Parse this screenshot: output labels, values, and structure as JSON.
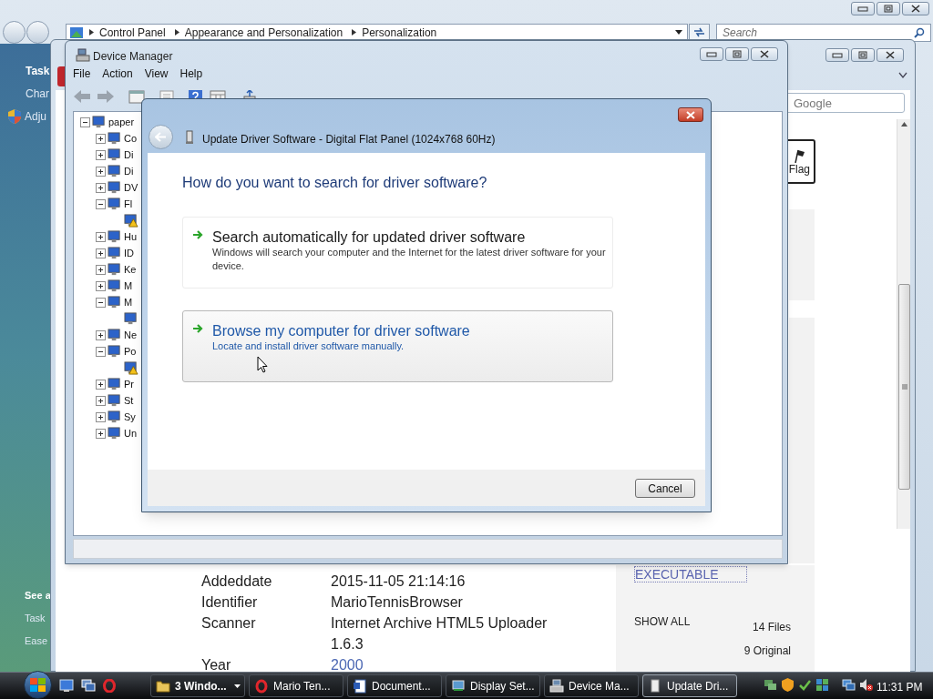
{
  "explorer": {
    "breadcrumb": [
      "Control Panel",
      "Appearance and Personalization",
      "Personalization"
    ],
    "search": {
      "placeholder": "Search"
    },
    "task_pane": {
      "top_links": [
        {
          "text": "Task",
          "kind": "heading"
        },
        {
          "text": "Char",
          "kind": "link"
        },
        {
          "text": "Adju",
          "kind": "shield"
        }
      ],
      "bottom_links": [
        "See a",
        "Task",
        "Ease"
      ]
    }
  },
  "browser": {
    "search": {
      "placeholder": "Google"
    },
    "flag_button": "Flag",
    "metadata": [
      {
        "label": "Addeddate",
        "value": "2015-11-05 21:14:16",
        "link": false
      },
      {
        "label": "Identifier",
        "value": "MarioTennisBrowser",
        "link": false
      },
      {
        "label": "Scanner",
        "value": "Internet Archive HTML5 Uploader 1.6.3",
        "link": false
      },
      {
        "label": "Year",
        "value": "2000",
        "link": true
      }
    ],
    "files_panel": {
      "format_link": "EXECUTABLE",
      "show_all": "SHOW ALL",
      "file_count": "14 Files",
      "original_count": "9 Original"
    }
  },
  "device_manager": {
    "title": "Device Manager",
    "menu": [
      "File",
      "Action",
      "View",
      "Help"
    ],
    "tree": {
      "label": "paper",
      "expanded": true,
      "children": [
        {
          "label": "Co",
          "expanded": false
        },
        {
          "label": "Di",
          "expanded": false
        },
        {
          "label": "Di",
          "expanded": false
        },
        {
          "label": "DV",
          "expanded": false
        },
        {
          "label": "Fl",
          "expanded": true,
          "children": [
            {
              "warning": true
            }
          ]
        },
        {
          "label": "Hu",
          "expanded": false
        },
        {
          "label": "ID",
          "expanded": false
        },
        {
          "label": "Ke",
          "expanded": false
        },
        {
          "label": "M",
          "expanded": false
        },
        {
          "label": "M",
          "expanded": true,
          "children": [
            {
              "warning": false
            }
          ]
        },
        {
          "label": "Ne",
          "expanded": false
        },
        {
          "label": "Po",
          "expanded": true,
          "children": [
            {
              "warning": true
            }
          ]
        },
        {
          "label": "Pr",
          "expanded": false
        },
        {
          "label": "St",
          "expanded": false
        },
        {
          "label": "Sy",
          "expanded": false
        },
        {
          "label": "Un",
          "expanded": false
        }
      ]
    }
  },
  "dialog": {
    "title": "Update Driver Software - Digital Flat Panel (1024x768 60Hz)",
    "question": "How do you want to search for driver software?",
    "options": [
      {
        "title": "Search automatically for updated driver software",
        "description": "Windows will search your computer and the Internet for the latest driver software for your device.",
        "hovered": false
      },
      {
        "title": "Browse my computer for driver software",
        "description": "Locate and install driver software manually.",
        "hovered": true
      }
    ],
    "cancel_button": "Cancel"
  },
  "taskbar": {
    "tasks": [
      {
        "label": "3 Windo...",
        "grouped": true,
        "selected": false
      },
      {
        "label": "Mario Ten...",
        "grouped": false,
        "selected": false
      },
      {
        "label": "Document...",
        "grouped": false,
        "selected": false
      },
      {
        "label": "Display Set...",
        "grouped": false,
        "selected": false
      },
      {
        "label": "Device Ma...",
        "grouped": false,
        "selected": false
      },
      {
        "label": "Update Dri...",
        "grouped": false,
        "selected": true
      }
    ],
    "clock": "11:31 PM"
  }
}
